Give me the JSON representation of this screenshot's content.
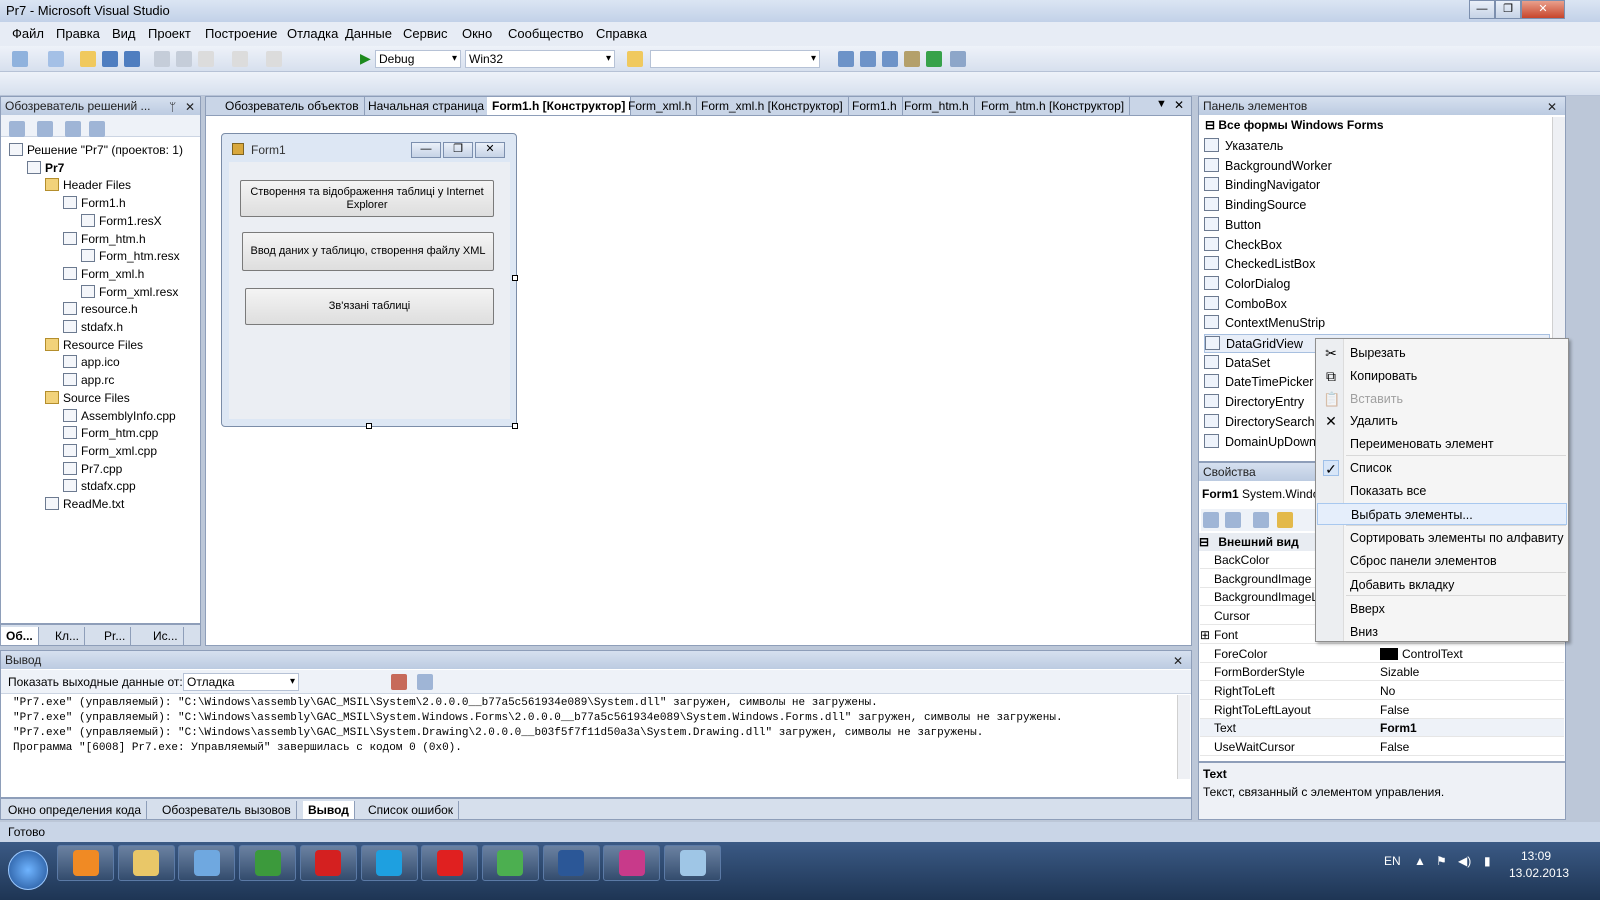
{
  "window": {
    "title": "Pr7 - Microsoft Visual Studio",
    "min": "—",
    "max": "❐",
    "close": "✕"
  },
  "menu": [
    "Файл",
    "Правка",
    "Вид",
    "Проект",
    "Построение",
    "Отладка",
    "Данные",
    "Сервис",
    "Окно",
    "Сообщество",
    "Справка"
  ],
  "toolbar": {
    "config": "Debug",
    "platform": "Win32",
    "find": ""
  },
  "solution": {
    "title": "Обозреватель решений ...",
    "pin": "ᛘ",
    "close": "✕",
    "tree": [
      {
        "label": "Решение \"Pr7\"  (проектов: 1)",
        "indent": 0,
        "kind": "sln"
      },
      {
        "label": "Pr7",
        "indent": 1,
        "kind": "proj",
        "bold": true
      },
      {
        "label": "Header Files",
        "indent": 2,
        "kind": "folder"
      },
      {
        "label": "Form1.h",
        "indent": 3,
        "kind": "file"
      },
      {
        "label": "Form1.resX",
        "indent": 4,
        "kind": "file"
      },
      {
        "label": "Form_htm.h",
        "indent": 3,
        "kind": "file"
      },
      {
        "label": "Form_htm.resx",
        "indent": 4,
        "kind": "file"
      },
      {
        "label": "Form_xml.h",
        "indent": 3,
        "kind": "file"
      },
      {
        "label": "Form_xml.resx",
        "indent": 4,
        "kind": "file"
      },
      {
        "label": "resource.h",
        "indent": 3,
        "kind": "file"
      },
      {
        "label": "stdafx.h",
        "indent": 3,
        "kind": "file"
      },
      {
        "label": "Resource Files",
        "indent": 2,
        "kind": "folder"
      },
      {
        "label": "app.ico",
        "indent": 3,
        "kind": "file"
      },
      {
        "label": "app.rc",
        "indent": 3,
        "kind": "file"
      },
      {
        "label": "Source Files",
        "indent": 2,
        "kind": "folder"
      },
      {
        "label": "AssemblyInfo.cpp",
        "indent": 3,
        "kind": "file"
      },
      {
        "label": "Form_htm.cpp",
        "indent": 3,
        "kind": "file"
      },
      {
        "label": "Form_xml.cpp",
        "indent": 3,
        "kind": "file"
      },
      {
        "label": "Pr7.cpp",
        "indent": 3,
        "kind": "file"
      },
      {
        "label": "stdafx.cpp",
        "indent": 3,
        "kind": "file"
      },
      {
        "label": "ReadMe.txt",
        "indent": 2,
        "kind": "file"
      }
    ],
    "bottom_tabs": [
      "Об...",
      "Кл...",
      "Pr...",
      "Ис..."
    ]
  },
  "doc_tabs": [
    {
      "label": "Обозреватель объектов",
      "active": false
    },
    {
      "label": "Начальная страница",
      "active": false
    },
    {
      "label": "Form1.h [Конструктор]",
      "active": true
    },
    {
      "label": "Form_xml.h",
      "active": false
    },
    {
      "label": "Form_xml.h [Конструктор]",
      "active": false
    },
    {
      "label": "Form1.h",
      "active": false
    },
    {
      "label": "Form_htm.h",
      "active": false
    },
    {
      "label": "Form_htm.h [Конструктор]",
      "active": false
    }
  ],
  "form1": {
    "title": "Form1",
    "buttons": [
      "Створення та відображення таблиці у Internet Explorer",
      "Ввод даних у таблицю, створення файлу XML",
      "Зв'язані таблиці"
    ]
  },
  "toolbox": {
    "title": "Панель элементов",
    "group": "Все формы Windows Forms",
    "items": [
      "Указатель",
      "BackgroundWorker",
      "BindingNavigator",
      "BindingSource",
      "Button",
      "CheckBox",
      "CheckedListBox",
      "ColorDialog",
      "ComboBox",
      "ContextMenuStrip",
      "DataGridView",
      "DataSet",
      "DateTimePicker",
      "DirectoryEntry",
      "DirectorySearche",
      "DomainUpDown"
    ],
    "selected": "DataGridView"
  },
  "context_menu": {
    "items": [
      {
        "label": "Вырезать",
        "icon": "cut-icon",
        "glyph": "✂",
        "disabled": false
      },
      {
        "label": "Копировать",
        "icon": "copy-icon",
        "glyph": "⧉",
        "disabled": false
      },
      {
        "label": "Вставить",
        "icon": "paste-icon",
        "glyph": "📋",
        "disabled": true
      },
      {
        "label": "Удалить",
        "icon": "delete-icon",
        "glyph": "✕",
        "disabled": false
      },
      {
        "label": "Переименовать элемент",
        "icon": "",
        "glyph": "",
        "disabled": false
      },
      {
        "label": "Список",
        "icon": "check-icon",
        "glyph": "✓",
        "disabled": false,
        "checked": true
      },
      {
        "label": "Показать все",
        "icon": "",
        "glyph": "",
        "disabled": false
      },
      {
        "label": "Выбрать элементы...",
        "icon": "",
        "glyph": "",
        "disabled": false,
        "highlighted": true
      },
      {
        "label": "Сортировать элементы по алфавиту",
        "icon": "",
        "glyph": "",
        "disabled": false
      },
      {
        "label": "Сброс панели элементов",
        "icon": "",
        "glyph": "",
        "disabled": false
      },
      {
        "label": "Добавить вкладку",
        "icon": "",
        "glyph": "",
        "disabled": false
      },
      {
        "label": "Вверх",
        "icon": "",
        "glyph": "",
        "disabled": false
      },
      {
        "label": "Вниз",
        "icon": "",
        "glyph": "",
        "disabled": false
      }
    ]
  },
  "properties": {
    "title": "Свойства",
    "object": "Form1",
    "object_type": "System.Windo",
    "category": "Внешний вид",
    "rows": [
      {
        "name": "BackColor",
        "value": ""
      },
      {
        "name": "BackgroundImage",
        "value": ""
      },
      {
        "name": "BackgroundImageL",
        "value": ""
      },
      {
        "name": "Cursor",
        "value": ""
      },
      {
        "name": "Font",
        "value": ""
      },
      {
        "name": "ForeColor",
        "value": "ControlText"
      },
      {
        "name": "FormBorderStyle",
        "value": "Sizable"
      },
      {
        "name": "RightToLeft",
        "value": "No"
      },
      {
        "name": "RightToLeftLayout",
        "value": "False"
      },
      {
        "name": "Text",
        "value": "Form1"
      },
      {
        "name": "UseWaitCursor",
        "value": "False"
      }
    ],
    "desc_title": "Text",
    "desc_text": "Текст, связанный с элементом управления."
  },
  "output": {
    "title": "Вывод",
    "show_label": "Показать выходные данные от:",
    "source": "Отладка",
    "lines": [
      "\"Pr7.exe\" (управляемый): \"C:\\Windows\\assembly\\GAC_MSIL\\System\\2.0.0.0__b77a5c561934e089\\System.dll\" загружен, символы не загружены.",
      "\"Pr7.exe\" (управляемый): \"C:\\Windows\\assembly\\GAC_MSIL\\System.Windows.Forms\\2.0.0.0__b77a5c561934e089\\System.Windows.Forms.dll\" загружен, символы не загружены.",
      "\"Pr7.exe\" (управляемый): \"C:\\Windows\\assembly\\GAC_MSIL\\System.Drawing\\2.0.0.0__b03f5f7f11d50a3a\\System.Drawing.dll\" загружен, символы не загружены.",
      "Программа \"[6008] Pr7.exe: Управляемый\" завершилась с кодом 0 (0x0)."
    ],
    "bottom_tabs": [
      "Окно определения кода",
      "Обозреватель вызовов",
      "Вывод",
      "Список ошибок"
    ]
  },
  "status": "Готово",
  "taskbar": {
    "lang": "EN",
    "time": "13:09",
    "date": "13.02.2013",
    "apps": [
      {
        "name": "media-player",
        "color": "#f08a24"
      },
      {
        "name": "explorer",
        "color": "#e9c768"
      },
      {
        "name": "mail",
        "color": "#6fa8e0"
      },
      {
        "name": "utorrent",
        "color": "#3c9a3c"
      },
      {
        "name": "opera",
        "color": "#d42020"
      },
      {
        "name": "skype",
        "color": "#1ea0e0"
      },
      {
        "name": "yandex",
        "color": "#e02020"
      },
      {
        "name": "chrome",
        "color": "#4caf50"
      },
      {
        "name": "word",
        "color": "#2b5797"
      },
      {
        "name": "visual-studio",
        "color": "#c83a8a"
      },
      {
        "name": "notepad",
        "color": "#9fc6e6"
      }
    ]
  }
}
